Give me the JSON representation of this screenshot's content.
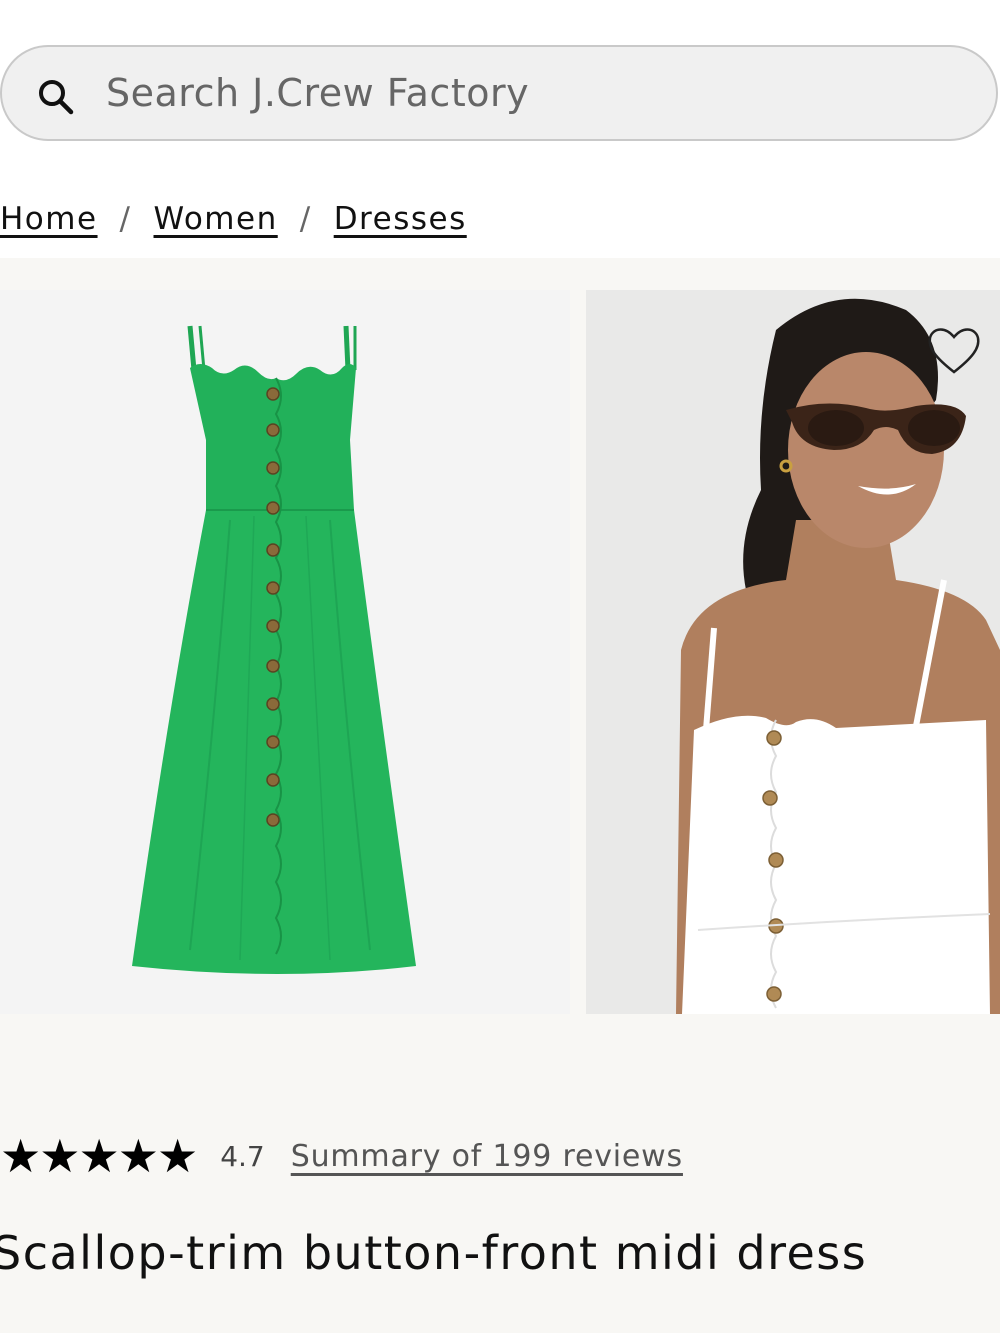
{
  "search": {
    "placeholder": "Search J.Crew Factory",
    "icon": "search-icon"
  },
  "breadcrumb": {
    "items": [
      "Home",
      "Women",
      "Dresses"
    ],
    "separator": "/"
  },
  "gallery": {
    "images": [
      {
        "description_icon": "green-dress-product-image",
        "dress_color": "#22b15a"
      },
      {
        "description_icon": "white-dress-model-image",
        "dress_color": "#ffffff"
      }
    ],
    "wishlist_icon": "heart-icon"
  },
  "product": {
    "stars": "★★★★★",
    "rating": "4.7",
    "reviews_link": "Summary of 199 reviews",
    "title": "Scallop-trim button-front midi dress"
  },
  "colors": {
    "page_bg": "#ffffff",
    "gallery_bg": "#f8f7f4",
    "search_bg": "#f0f0f0"
  }
}
